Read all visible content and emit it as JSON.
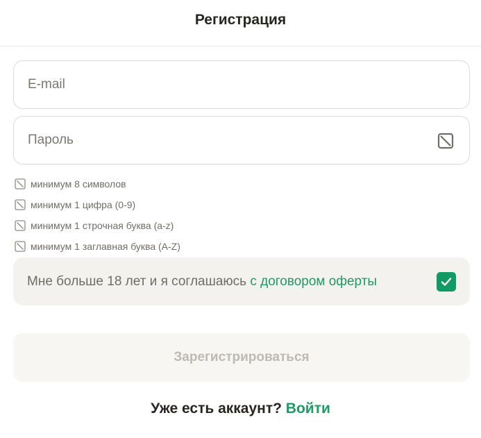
{
  "header": {
    "title": "Регистрация"
  },
  "form": {
    "email": {
      "value": "",
      "placeholder": "E-mail"
    },
    "password": {
      "value": "",
      "placeholder": "Пароль",
      "toggle_icon": "eye-off-icon"
    },
    "rules": [
      {
        "label": "минимум 8 символов",
        "met": false
      },
      {
        "label": "минимум 1 цифра (0-9)",
        "met": false
      },
      {
        "label": "минимум 1 строчная буква (a-z)",
        "met": false
      },
      {
        "label": "минимум 1 заглавная буква (A-Z)",
        "met": false
      }
    ],
    "agreement": {
      "text": "Мне больше 18 лет и я соглашаюсь ",
      "link": "с договором оферты",
      "checked": true
    },
    "submit_label": "Зарегистрироваться"
  },
  "footer": {
    "question": "Уже есть аккаунт? ",
    "login_link": "Войти"
  },
  "colors": {
    "accent": "#119a63",
    "link": "#1e9a66",
    "muted_text": "#6f6d67",
    "disabled_text": "#bdbab3"
  }
}
